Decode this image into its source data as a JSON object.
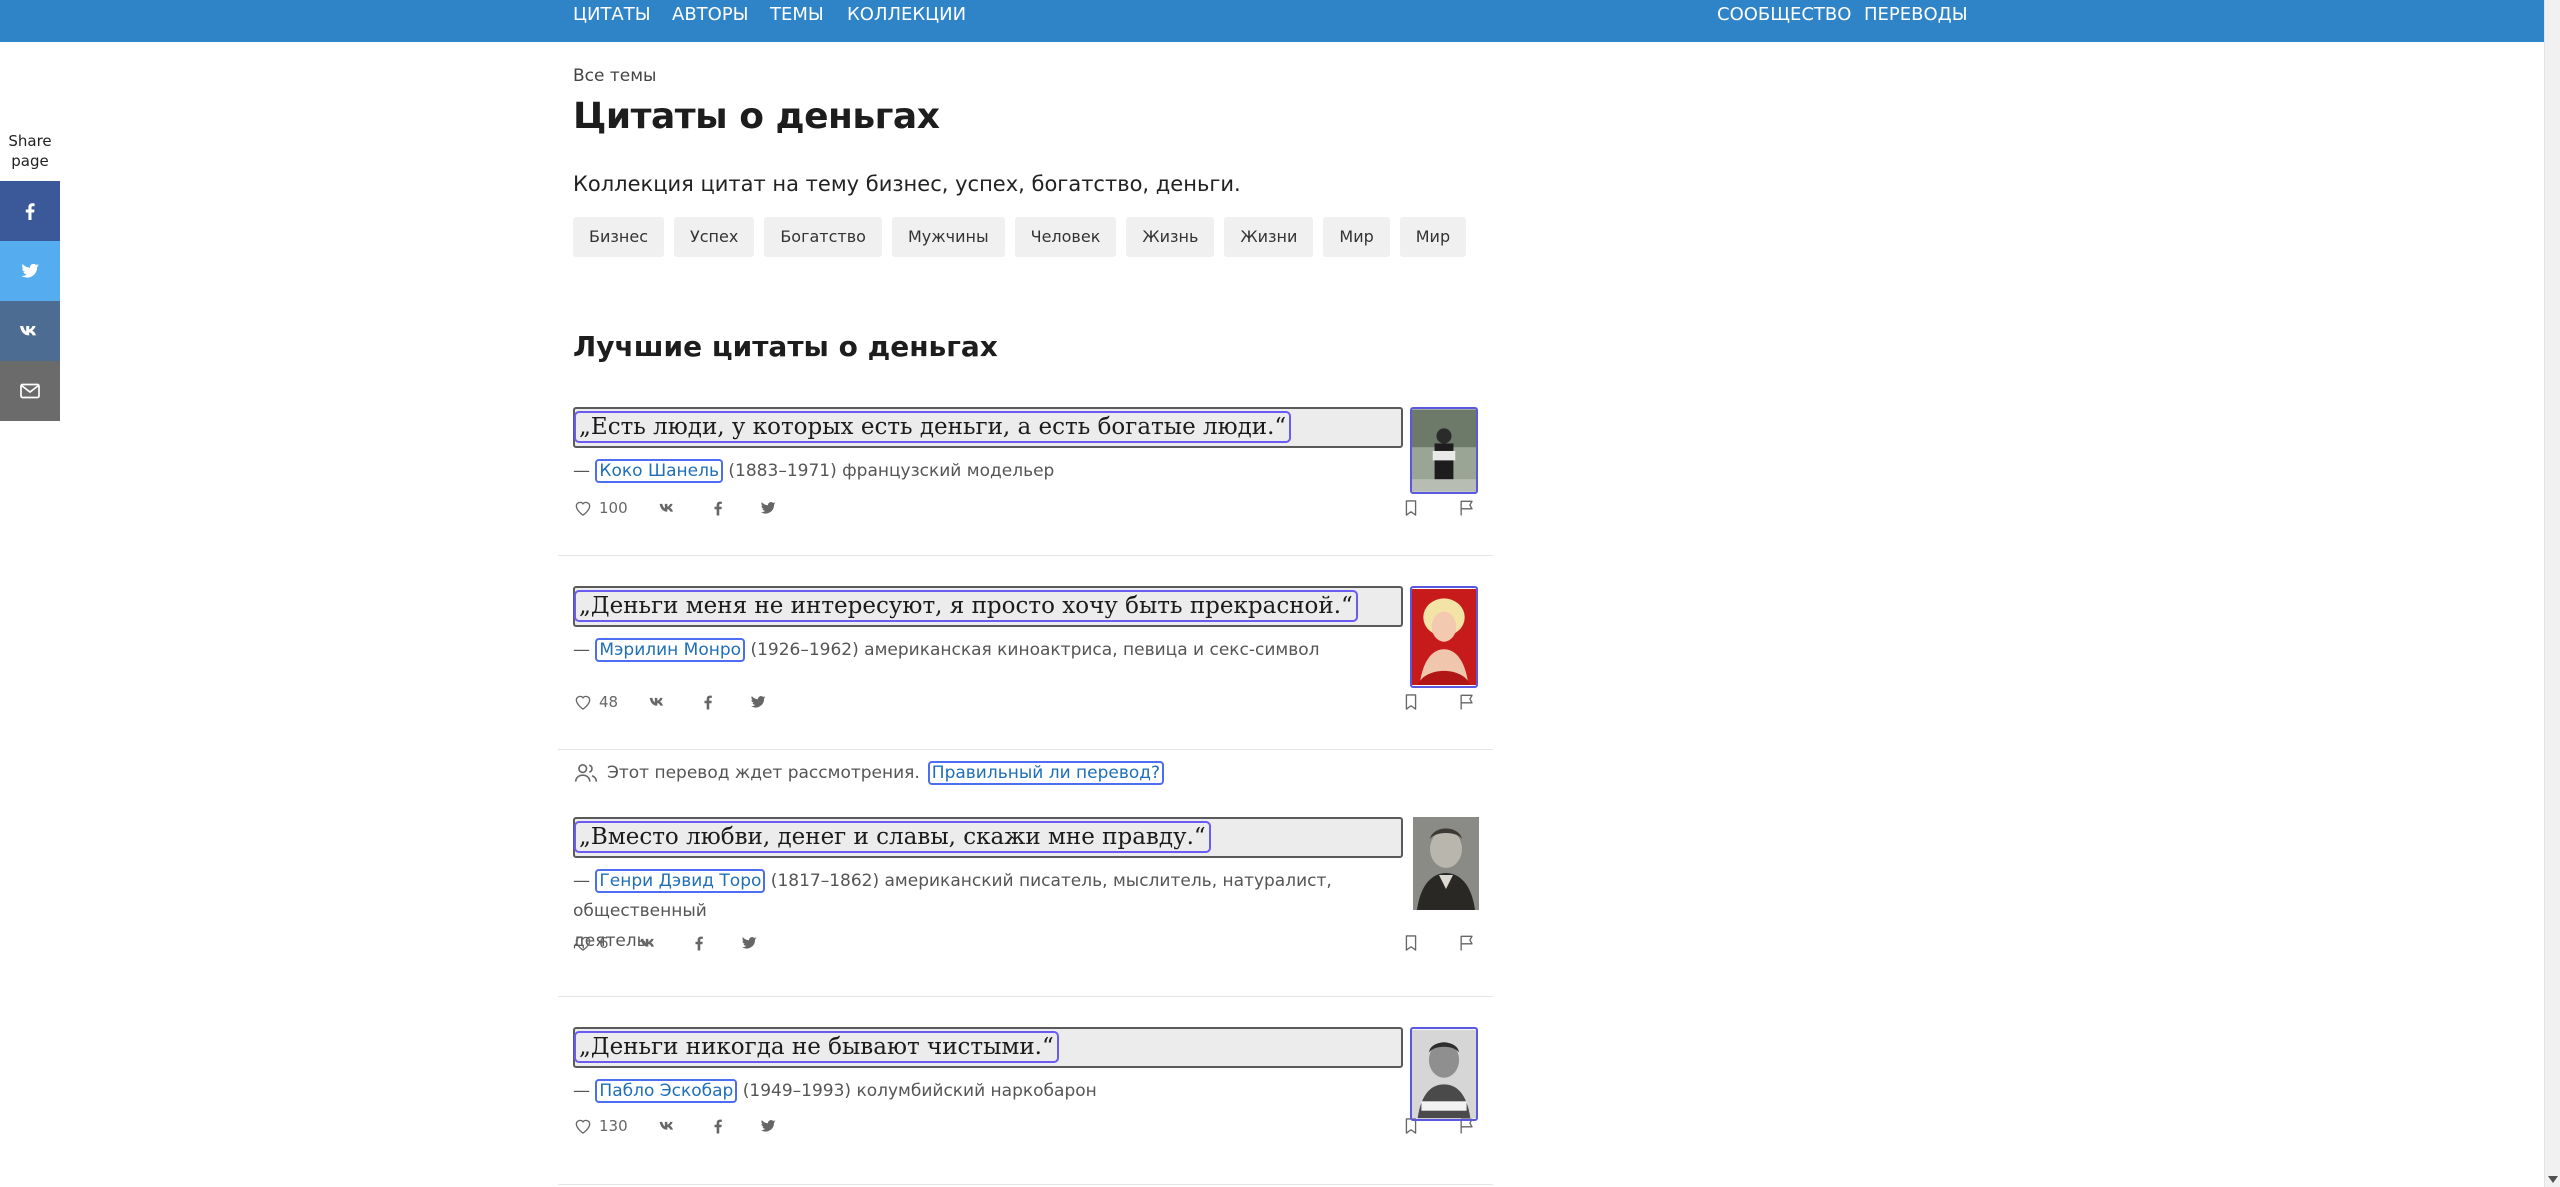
{
  "nav": {
    "left": [
      "ЦИТАТЫ",
      "АВТОРЫ",
      "ТЕМЫ",
      "КОЛЛЕКЦИИ"
    ],
    "right": [
      "СООБЩЕСТВО",
      "ПЕРЕВОДЫ"
    ]
  },
  "share": {
    "label_line1": "Share",
    "label_line2": "page",
    "buttons": [
      {
        "icon": "facebook-icon",
        "color": "#3b5998"
      },
      {
        "icon": "twitter-icon",
        "color": "#55acee"
      },
      {
        "icon": "vk-icon",
        "color": "#4c6c91"
      },
      {
        "icon": "mail-icon",
        "color": "#6b6b6b"
      }
    ]
  },
  "breadcrumb": "Все темы",
  "title": "Цитаты о деньгах",
  "description": "Коллекция цитат на тему бизнес, успех, богатство, деньги.",
  "tags": [
    "Бизнес",
    "Успех",
    "Богатство",
    "Мужчины",
    "Человек",
    "Жизнь",
    "Жизни",
    "Мир",
    "Мир"
  ],
  "section_title": "Лучшие цитаты о деньгах",
  "quotes": [
    {
      "text": "„Есть люди, у которых есть деньги, а есть богатые люди.“",
      "dash": "— ",
      "author": "Коко Шанель",
      "meta": " (1883–1971) французский модельер",
      "likes": "100"
    },
    {
      "text": "„Деньги меня не интересуют, я просто хочу быть прекрасной.“",
      "dash": "— ",
      "author": "Мэрилин Монро",
      "meta": " (1926–1962) американская киноактриса, певица и секс-символ",
      "likes": "48"
    },
    {
      "review_text": "Этот перевод ждет рассмотрения.",
      "review_link": "Правильный ли перевод?",
      "text": "„Вместо любви, денег и славы, скажи мне правду.“",
      "dash": "— ",
      "author": "Генри Дэвид Торо",
      "meta": " (1817–1862) американский писатель, мыслитель, натуралист, общественный",
      "meta2": "деятель",
      "likes": "6"
    },
    {
      "text": "„Деньги никогда не бывают чистыми.“",
      "dash": "— ",
      "author": "Пабло Эскобар",
      "meta": " (1949–1993) колумбийский наркобарон",
      "likes": "130"
    }
  ],
  "colors": {
    "nav_bg": "#2f84c8",
    "link": "#1f6fb7",
    "focus_outline": "#4d6df2"
  }
}
